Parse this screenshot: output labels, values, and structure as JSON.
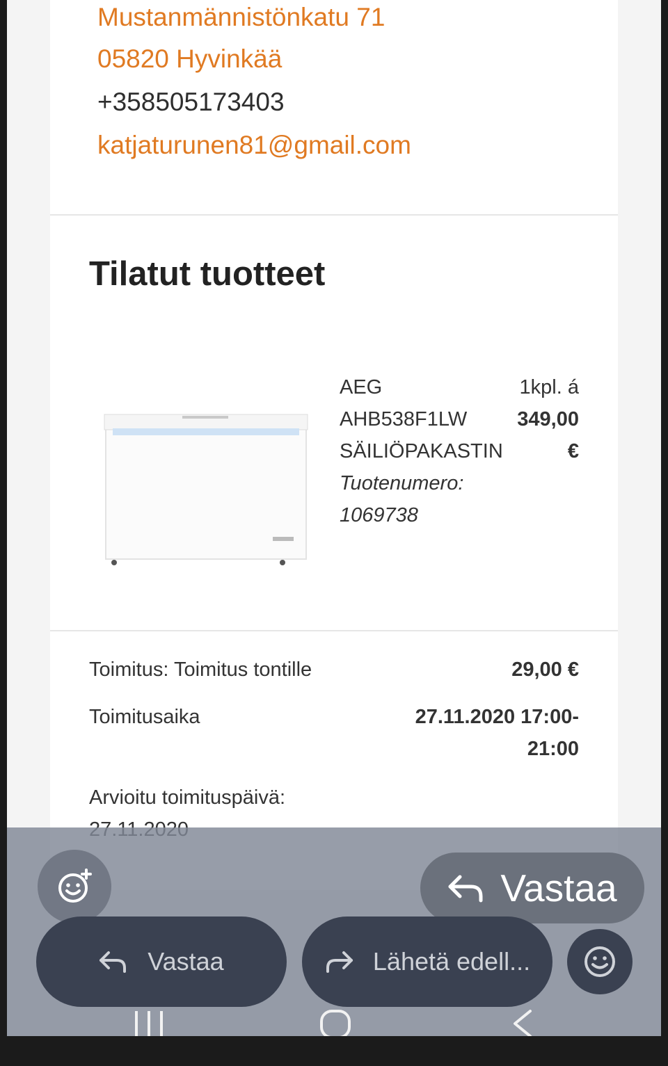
{
  "address": {
    "street": "Mustanmännistönkatu 71",
    "city": "05820 Hyvinkää",
    "phone": "+358505173403",
    "email": "katjaturunen81@gmail.com"
  },
  "ordered": {
    "title": "Tilatut tuotteet",
    "product": {
      "name_line1": "AEG",
      "name_line2": "AHB538F1LW",
      "name_line3": "SÄILIÖPAKASTIN",
      "number_label": "Tuotenumero:",
      "number": "1069738",
      "qty": "1kpl. á",
      "price": "349,00",
      "currency": "€",
      "image_icon": "chest-freezer-image"
    }
  },
  "delivery": {
    "method_label": "Toimitus: Toimitus tontille",
    "method_price": "29,00 €",
    "time_label": "Toimitusaika",
    "time_value_line1": "27.11.2020 17:00-",
    "time_value_line2": "21:00",
    "estimated_label": "Arvioitu toimituspäivä:",
    "estimated_date": "27.11.2020"
  },
  "actions": {
    "fab_reply": "Vastaa",
    "reply": "Vastaa",
    "forward": "Lähetä edell..."
  },
  "colors": {
    "accent_orange": "#e07a22",
    "pill_bg": "#3a4151",
    "overlay": "#808796"
  }
}
